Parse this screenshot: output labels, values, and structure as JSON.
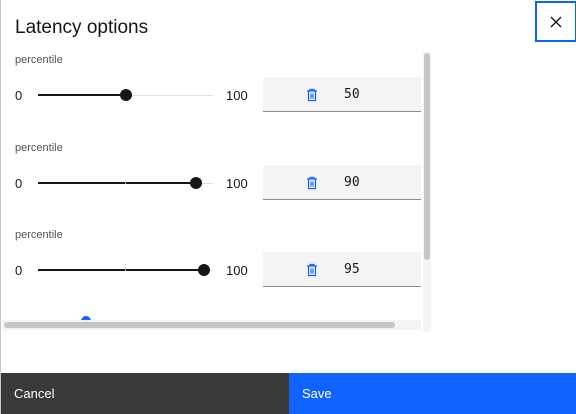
{
  "modal": {
    "title": "Latency options",
    "close_icon": "close-icon"
  },
  "rows": [
    {
      "label": "percentile",
      "min": "0",
      "max": "100",
      "value": "50",
      "slider_value": 50,
      "icon": "trash-icon"
    },
    {
      "label": "percentile",
      "min": "0",
      "max": "100",
      "value": "90",
      "slider_value": 90,
      "icon": "trash-icon"
    },
    {
      "label": "percentile",
      "min": "0",
      "max": "100",
      "value": "95",
      "slider_value": 95,
      "icon": "trash-icon"
    }
  ],
  "footer": {
    "cancel_label": "Cancel",
    "save_label": "Save"
  },
  "colors": {
    "primary": "#0f62fe",
    "secondary": "#393939",
    "field_bg": "#f4f4f4",
    "text": "#161616"
  }
}
